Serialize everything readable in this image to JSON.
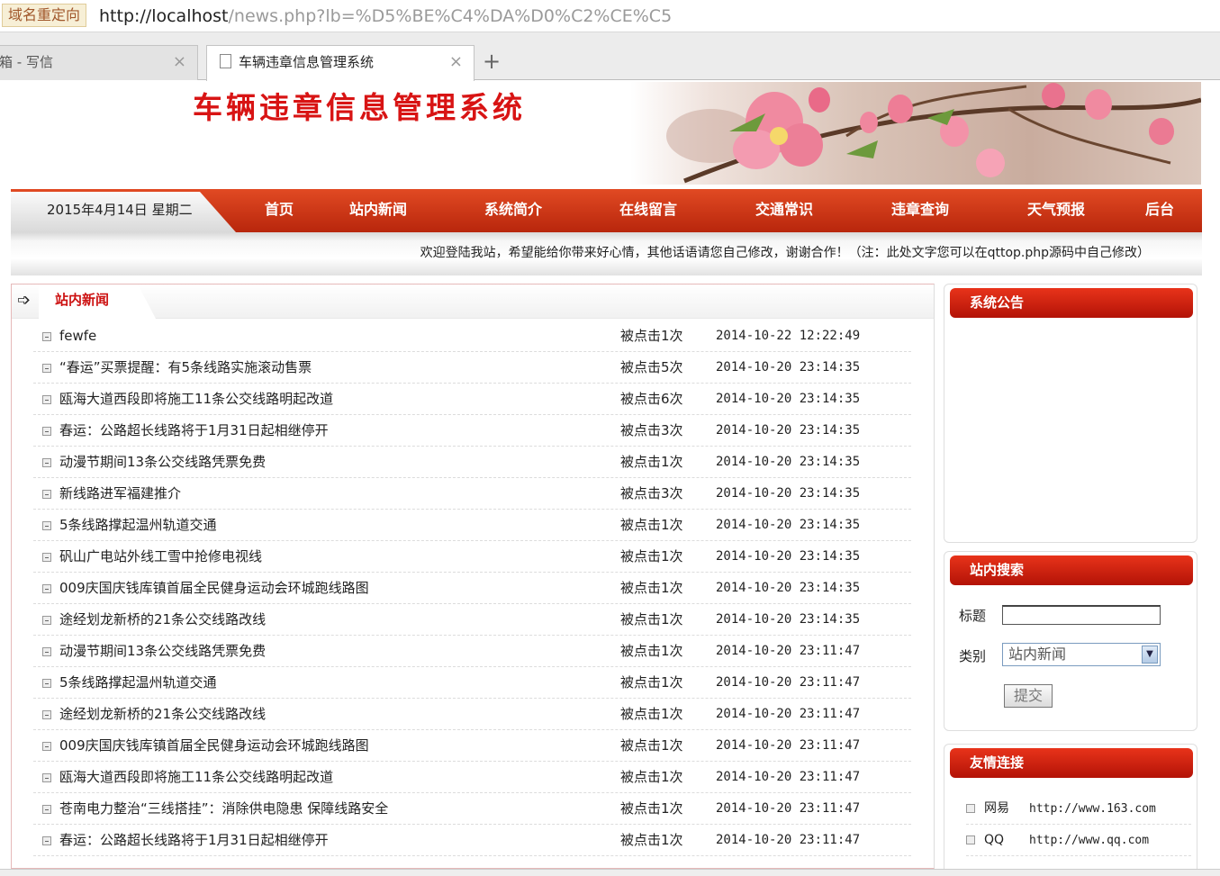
{
  "browser": {
    "redirect_label": "域名重定向",
    "url_host": "http://localhost",
    "url_path": "/news.php?lb=%D5%BE%C4%DA%D0%C2%CE%C5",
    "tabs": [
      {
        "label": "箱 - 写信"
      },
      {
        "label": "车辆违章信息管理系统"
      }
    ],
    "close_glyph": "×",
    "new_tab_glyph": "+"
  },
  "site": {
    "title": "车辆违章信息管理系统"
  },
  "nav": {
    "date": "2015年4月14日 星期二",
    "items": [
      "首页",
      "站内新闻",
      "系统简介",
      "在线留言",
      "交通常识",
      "违章查询",
      "天气预报",
      "后台"
    ]
  },
  "welcome": "欢迎登陆我站，希望能给你带来好心情，其他话语请您自己修改，谢谢合作！（注：此处文字您可以在qttop.php源码中自己修改）",
  "news": {
    "section_title": "站内新闻",
    "items": [
      {
        "title": "fewfe",
        "hits": "被点击1次",
        "time": "2014-10-22 12:22:49"
      },
      {
        "title": "“春运”买票提醒：有5条线路实施滚动售票",
        "hits": "被点击5次",
        "time": "2014-10-20 23:14:35"
      },
      {
        "title": "瓯海大道西段即将施工11条公交线路明起改道",
        "hits": "被点击6次",
        "time": "2014-10-20 23:14:35"
      },
      {
        "title": "春运：公路超长线路将于1月31日起相继停开",
        "hits": "被点击3次",
        "time": "2014-10-20 23:14:35"
      },
      {
        "title": "动漫节期间13条公交线路凭票免费",
        "hits": "被点击1次",
        "time": "2014-10-20 23:14:35"
      },
      {
        "title": "新线路进军福建推介",
        "hits": "被点击3次",
        "time": "2014-10-20 23:14:35"
      },
      {
        "title": "5条线路撑起温州轨道交通",
        "hits": "被点击1次",
        "time": "2014-10-20 23:14:35"
      },
      {
        "title": "矾山广电站外线工雪中抢修电视线",
        "hits": "被点击1次",
        "time": "2014-10-20 23:14:35"
      },
      {
        "title": "009庆国庆钱库镇首届全民健身运动会环城跑线路图",
        "hits": "被点击1次",
        "time": "2014-10-20 23:14:35"
      },
      {
        "title": "途经划龙新桥的21条公交线路改线",
        "hits": "被点击1次",
        "time": "2014-10-20 23:14:35"
      },
      {
        "title": "动漫节期间13条公交线路凭票免费",
        "hits": "被点击1次",
        "time": "2014-10-20 23:11:47"
      },
      {
        "title": "5条线路撑起温州轨道交通",
        "hits": "被点击1次",
        "time": "2014-10-20 23:11:47"
      },
      {
        "title": "途经划龙新桥的21条公交线路改线",
        "hits": "被点击1次",
        "time": "2014-10-20 23:11:47"
      },
      {
        "title": "009庆国庆钱库镇首届全民健身运动会环城跑线路图",
        "hits": "被点击1次",
        "time": "2014-10-20 23:11:47"
      },
      {
        "title": "瓯海大道西段即将施工11条公交线路明起改道",
        "hits": "被点击1次",
        "time": "2014-10-20 23:11:47"
      },
      {
        "title": "苍南电力整治“三线搭挂”：消除供电隐患 保障线路安全",
        "hits": "被点击1次",
        "time": "2014-10-20 23:11:47"
      },
      {
        "title": "春运：公路超长线路将于1月31日起相继停开",
        "hits": "被点击1次",
        "time": "2014-10-20 23:11:47"
      }
    ]
  },
  "sidebar": {
    "notice_title": "系统公告",
    "search": {
      "title": "站内搜索",
      "title_label": "标题",
      "title_value": "",
      "category_label": "类别",
      "category_value": "站内新闻",
      "submit_label": "提交"
    },
    "links": {
      "title": "友情连接",
      "items": [
        {
          "name": "网易",
          "url": "http://www.163.com"
        },
        {
          "name": "QQ",
          "url": "http://www.qq.com"
        }
      ]
    }
  },
  "colors": {
    "title_red": "#d81414",
    "nav_red": "#c8321a",
    "header_red": "#cc1010"
  },
  "icons": [
    "arrow-right-icon",
    "bullet-square-icon",
    "dropdown-arrow-icon",
    "page-icon"
  ]
}
